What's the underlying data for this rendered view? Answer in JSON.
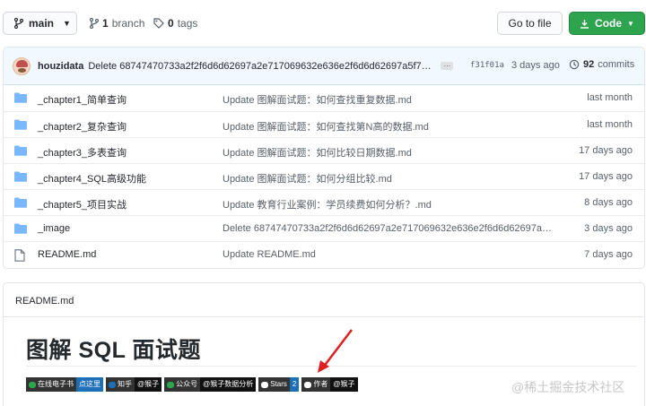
{
  "toolbar": {
    "branch": "main",
    "branches_count": "1",
    "branches_label": "branch",
    "tags_count": "0",
    "tags_label": "tags",
    "goto_file": "Go to file",
    "code": "Code"
  },
  "commit": {
    "author": "houzidata",
    "message": "Delete 68747470733a2f2f6d6d62697a2e717069632e636e2f6d6d62697a5f706...",
    "sha": "f31f01a",
    "time": "3 days ago",
    "count": "92",
    "count_label": "commits"
  },
  "files": [
    {
      "type": "folder",
      "name": "_chapter1_简单查询",
      "message": "Update 图解面试题：如何查找重复数据.md",
      "time": "last month"
    },
    {
      "type": "folder",
      "name": "_chapter2_复杂查询",
      "message": "Update 图解面试题：如何查找第N高的数据.md",
      "time": "last month"
    },
    {
      "type": "folder",
      "name": "_chapter3_多表查询",
      "message": "Update 图解面试题：如何比较日期数据.md",
      "time": "17 days ago"
    },
    {
      "type": "folder",
      "name": "_chapter4_SQL高级功能",
      "message": "Update 图解面试题：如何分组比较.md",
      "time": "17 days ago"
    },
    {
      "type": "folder",
      "name": "_chapter5_项目实战",
      "message": "Update 教育行业案例：学员续费如何分析？.md",
      "time": "8 days ago"
    },
    {
      "type": "folder",
      "name": "_image",
      "message": "Delete 68747470733a2f2f6d6d62697a2e717069632e636e2f6d6d62697a5...",
      "time": "3 days ago"
    },
    {
      "type": "file",
      "name": "README.md",
      "message": "Update README.md",
      "time": "7 days ago"
    }
  ],
  "readme": {
    "header": "README.md",
    "title": "图解 SQL 面试题",
    "badges": [
      {
        "left": "在线电子书",
        "right": "点这里",
        "icon_color": "#2ea44f",
        "right_color": "blue"
      },
      {
        "left": "知乎",
        "right": "@猴子",
        "icon_color": "#1d6fb8",
        "right_color": "dark"
      },
      {
        "left": "公众号",
        "right": "@猴子数据分析",
        "icon_color": "#2ea44f",
        "right_color": "dark"
      },
      {
        "left": "Stars",
        "right": "2",
        "icon_color": "#ffffff",
        "right_color": "blue"
      },
      {
        "left": "作者",
        "right": "@猴子",
        "icon_color": "#ffffff",
        "right_color": "dark"
      }
    ]
  },
  "watermark": "@稀土掘金技术社区",
  "colors": {
    "accent_green": "#2ea44f",
    "folder_blue": "#79b8ff",
    "arrow_red": "#e02020",
    "commit_bar": "#f1f8ff"
  }
}
